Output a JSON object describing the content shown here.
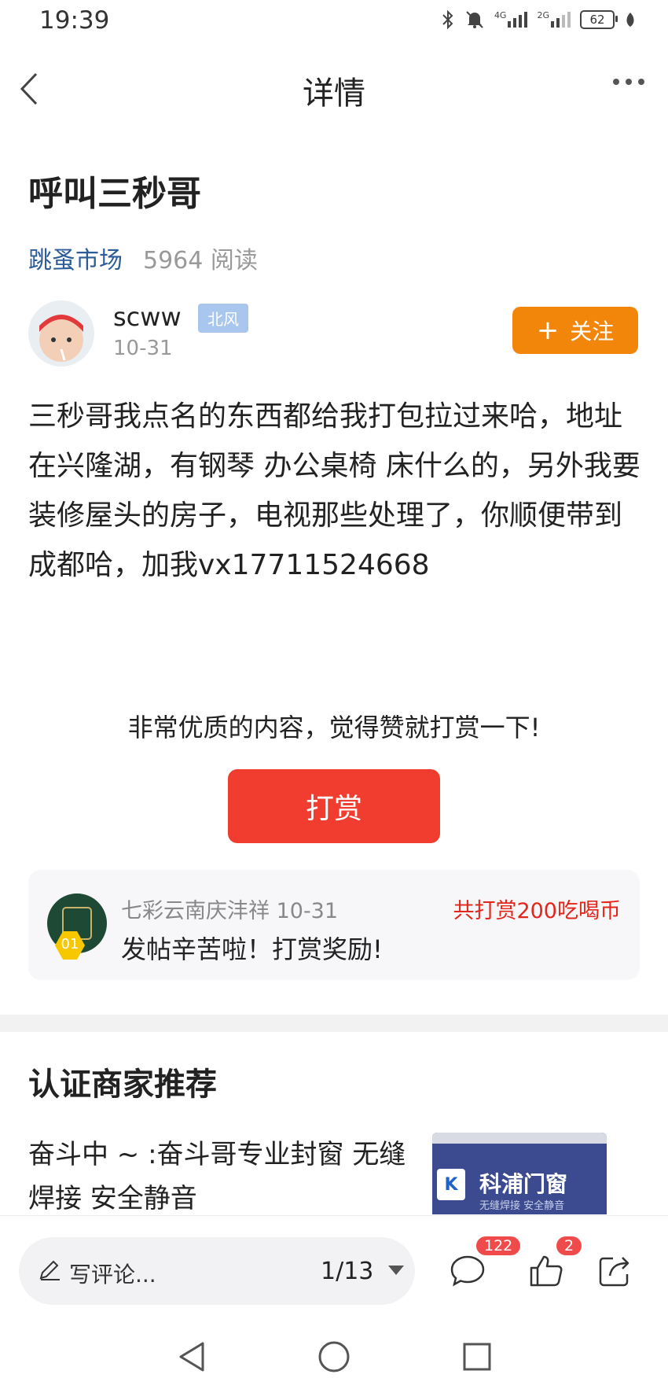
{
  "status_bar": {
    "time": "19:39",
    "network1": "4G",
    "network2": "2G",
    "battery": "62"
  },
  "nav": {
    "title": "详情"
  },
  "article": {
    "title": "呼叫三秒哥",
    "forum": "跳蚤市场",
    "read_count": "5964 阅读",
    "author": {
      "name": "scww",
      "tag": "北风",
      "date": "10-31"
    },
    "follow_label": "关注",
    "body": "三秒哥我点名的东西都给我打包拉过来哈，地址在兴隆湖，有钢琴 办公桌椅 床什么的，另外我要装修屋头的房子，电视那些处理了，你顺便带到成都哈，加我vx17711524668"
  },
  "reward": {
    "prompt": "非常优质的内容，觉得赞就打赏一下!",
    "button_label": "打赏",
    "record": {
      "rank": "01",
      "name_date": "七彩云南庆沣祥 10-31",
      "message": "发帖辛苦啦！打赏奖励!",
      "total": "共打赏200吃喝币"
    }
  },
  "recommend": {
    "title": "认证商家推荐",
    "items": [
      {
        "text": "奋斗中 ~ :奋斗哥专业封窗 无缝焊接 安全静音",
        "thumb_brand": "科浦门窗",
        "thumb_slogan": "无缝焊接 安全静音",
        "thumb_logo": "K"
      }
    ]
  },
  "bottom_bar": {
    "comment_placeholder": "写评论...",
    "page": "1/13",
    "comment_count": "122",
    "like_count": "2"
  },
  "colors": {
    "accent_orange": "#f2860b",
    "reward_red": "#f03d30",
    "link_blue": "#2d5d99"
  }
}
